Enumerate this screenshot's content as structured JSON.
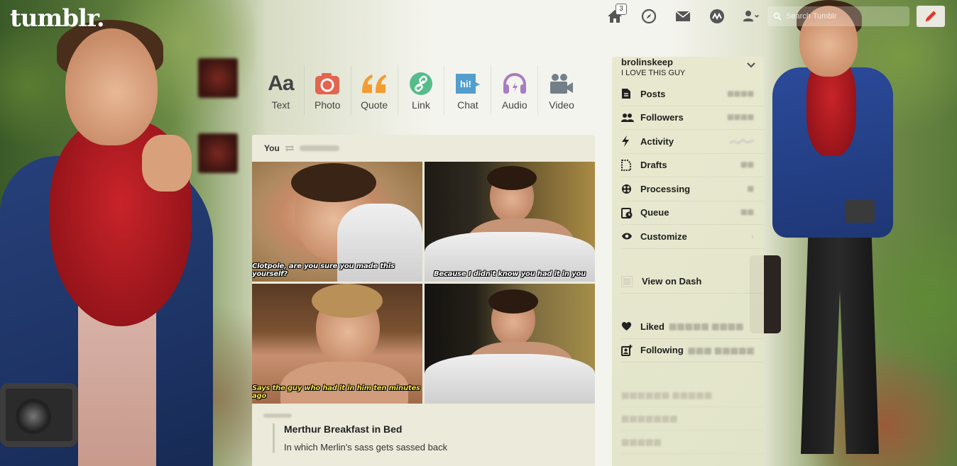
{
  "brand": {
    "logo_text": "tumblr."
  },
  "nav": {
    "inbox_badge": "3",
    "search_placeholder": "Search Tumblr"
  },
  "post_types": [
    {
      "label": "Text",
      "icon": "text-icon",
      "color": "#444444"
    },
    {
      "label": "Photo",
      "icon": "camera-icon",
      "color": "#e2654f"
    },
    {
      "label": "Quote",
      "icon": "quote-icon",
      "color": "#f29c33"
    },
    {
      "label": "Link",
      "icon": "link-icon",
      "color": "#56bc8a"
    },
    {
      "label": "Chat",
      "icon": "chat-icon",
      "color": "#529ecc"
    },
    {
      "label": "Audio",
      "icon": "headphones-icon",
      "color": "#a77dc2"
    },
    {
      "label": "Video",
      "icon": "video-icon",
      "color": "#748089"
    }
  ],
  "post": {
    "header_you": "You",
    "gif_captions": [
      "Clotpole, are you sure you made this yourself?",
      "Because I didn't know you had it in you",
      "Says the guy who had it in him ten minutes ago",
      ""
    ],
    "title": "Merthur Breakfast in Bed",
    "body": "In which Merlin's sass gets sassed back"
  },
  "sidebar": {
    "blog_name": "brolinskeep",
    "blog_title": "I LOVE THIS GUY",
    "items": [
      {
        "label": "Posts",
        "icon": "posts-icon"
      },
      {
        "label": "Followers",
        "icon": "followers-icon"
      },
      {
        "label": "Activity",
        "icon": "lightning-icon"
      },
      {
        "label": "Drafts",
        "icon": "drafts-icon"
      },
      {
        "label": "Processing",
        "icon": "processing-icon"
      },
      {
        "label": "Queue",
        "icon": "queue-icon"
      },
      {
        "label": "Customize",
        "icon": "eye-icon"
      }
    ],
    "view_on_dash": "View on Dash",
    "liked": "Liked",
    "following": "Following"
  },
  "colors": {
    "panel": "#eceadb",
    "sidebar": "#e6e6cc",
    "compose_pencil": "#e0362b"
  }
}
